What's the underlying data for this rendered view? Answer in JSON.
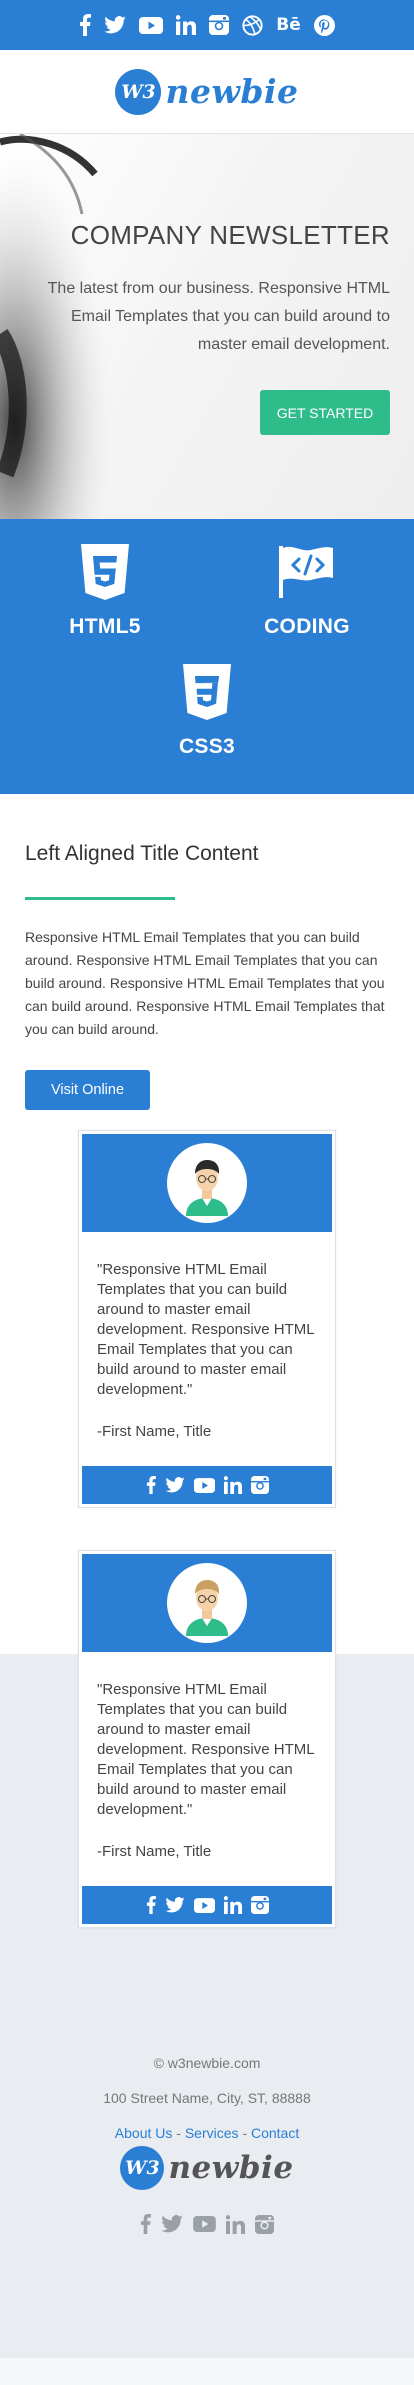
{
  "colors": {
    "brand_blue": "#2a7fd4",
    "accent_green": "#2ebc8a",
    "footer_bg": "#e9ecf0"
  },
  "topbar": {
    "icons": [
      "facebook-icon",
      "twitter-icon",
      "youtube-icon",
      "linkedin-icon",
      "instagram-icon",
      "dribbble-icon",
      "behance-icon",
      "pinterest-icon"
    ],
    "behance_text": "Bē"
  },
  "brand": {
    "badge": "W3",
    "name": "newbie"
  },
  "hero": {
    "title": "COMPANY NEWSLETTER",
    "description": "The latest from our business. Responsive HTML Email Templates that you can build around to master email development.",
    "button": "GET STARTED"
  },
  "features": [
    {
      "icon": "html5-icon",
      "label": "HTML5"
    },
    {
      "icon": "coding-flag-icon",
      "label": "CODING"
    },
    {
      "icon": "css3-icon",
      "label": "CSS3"
    }
  ],
  "content": {
    "title": "Left Aligned Title Content",
    "body": "Responsive HTML Email Templates that you can build around. Responsive HTML Email Templates that you can build around. Responsive HTML Email Templates that you can build around. Responsive HTML Email Templates that you can build around.",
    "button": "Visit Online"
  },
  "testimonials": [
    {
      "avatar_icon": "person-avatar-icon",
      "quote": "\"Responsive HTML Email Templates that you can build around to master email development. Responsive HTML Email Templates that you can build around to master email development.\"",
      "signature": "-First Name, Title",
      "social_icons": [
        "facebook-icon",
        "twitter-icon",
        "youtube-icon",
        "linkedin-icon",
        "instagram-icon"
      ]
    },
    {
      "avatar_icon": "person-avatar-icon",
      "quote": "\"Responsive HTML Email Templates that you can build around to master email development. Responsive HTML Email Templates that you can build around to master email development.\"",
      "signature": "-First Name, Title",
      "social_icons": [
        "facebook-icon",
        "twitter-icon",
        "youtube-icon",
        "linkedin-icon",
        "instagram-icon"
      ]
    }
  ],
  "footer": {
    "copyright": "© w3newbie.com",
    "address": "100 Street Name, City, ST, 88888",
    "links": [
      {
        "label": "About Us"
      },
      {
        "label": "Services"
      },
      {
        "label": "Contact"
      }
    ],
    "separator": " - ",
    "social_icons": [
      "facebook-icon",
      "twitter-icon",
      "youtube-icon",
      "linkedin-icon",
      "instagram-icon"
    ]
  }
}
